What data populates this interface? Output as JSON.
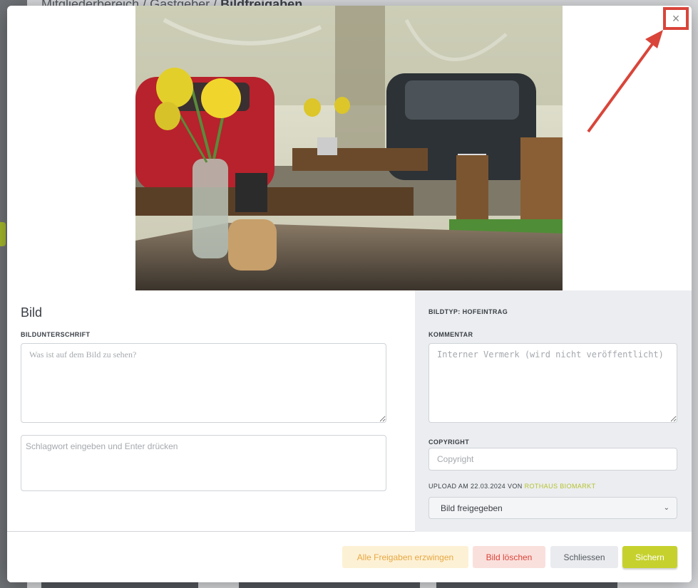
{
  "background": {
    "breadcrumb": {
      "part1": "Mitgliederbereich /",
      "part2": "Gastgeber /",
      "current": "Bildfreigaben"
    }
  },
  "modal": {
    "close_icon": "×",
    "photo_alt": "Café-Tisch mit gelben Tulpen in einer Glaskaraffe vor einem Fenster",
    "left": {
      "title": "Bild",
      "caption_label": "BILDUNTERSCHRIFT",
      "caption_placeholder": "Was ist auf dem Bild zu sehen?",
      "tags_placeholder": "Schlagwort eingeben und Enter drücken"
    },
    "right": {
      "image_type": "BILDTYP: HOFEINTRAG",
      "comment_label": "KOMMENTAR",
      "comment_placeholder": "Interner Vermerk (wird nicht veröffentlicht)",
      "copyright_label": "COPYRIGHT",
      "copyright_placeholder": "Copyright",
      "upload_text": "UPLOAD AM 22.03.2024 VON",
      "upload_user": "ROTHAUS BIOMARKT",
      "status_value": "Bild freigegeben",
      "status_chevron": "⌄"
    },
    "footer": {
      "force_label": "Alle Freigaben erzwingen",
      "delete_label": "Bild löschen",
      "close_label": "Schliessen",
      "save_label": "Sichern"
    }
  },
  "colors": {
    "accent_green": "#c6d12e",
    "danger_red": "#d9453a",
    "warning_orange": "#e6a844",
    "annotation_red": "#d9453a"
  }
}
